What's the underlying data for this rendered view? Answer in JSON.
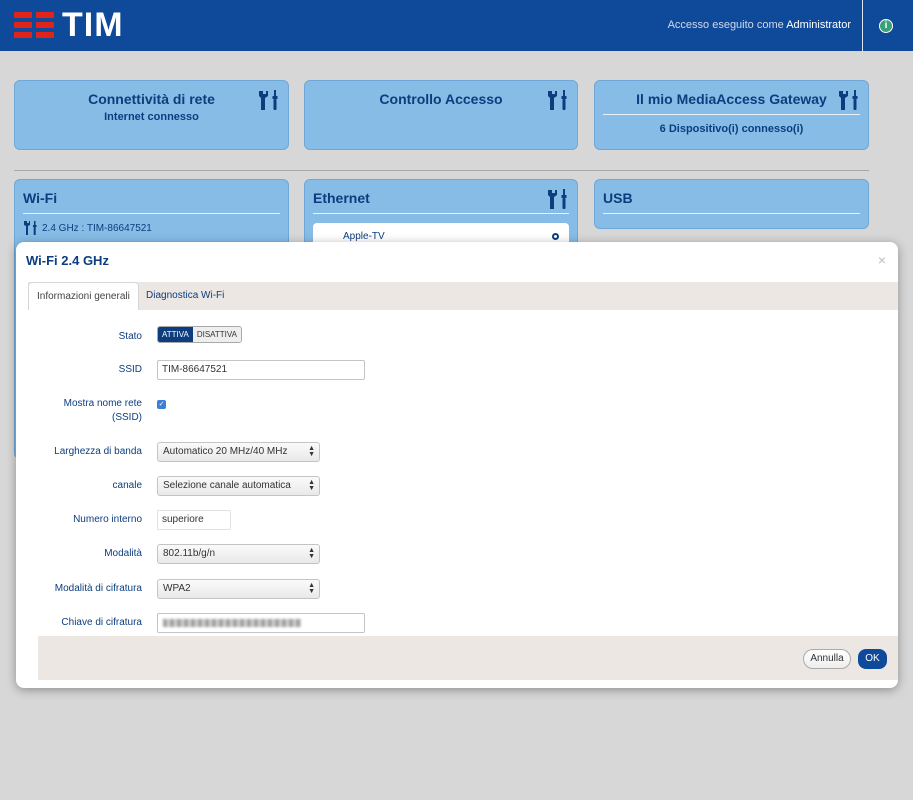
{
  "header": {
    "brand": "TIM",
    "login_prefix": "Accesso eseguito come",
    "login_user": "Administrator"
  },
  "cards": {
    "connectivity": {
      "title": "Connettività di rete",
      "subtitle": "Internet connesso"
    },
    "access_control": {
      "title": "Controllo Accesso"
    },
    "gateway": {
      "title": "Il mio MediaAccess Gateway",
      "subtitle": "6 Dispositivo(i) connesso(i)"
    },
    "wifi": {
      "title": "Wi-Fi",
      "band_label": "2.4 GHz : TIM-86647521"
    },
    "ethernet": {
      "title": "Ethernet",
      "device": "Apple-TV"
    },
    "usb": {
      "title": "USB"
    }
  },
  "modal": {
    "title": "Wi-Fi 2.4 GHz",
    "close": "×",
    "tabs": [
      "Informazioni generali",
      "Diagnostica Wi-Fi"
    ],
    "form": {
      "stato_label": "Stato",
      "stato_on": "ATTIVA",
      "stato_off": "DISATTIVA",
      "ssid_label": "SSID",
      "ssid_value": "TIM-86647521",
      "mostra_label_1": "Mostra nome rete",
      "mostra_label_2": "(SSID)",
      "banda_label": "Larghezza di banda",
      "banda_value": "Automatico 20 MHz/40 MHz",
      "canale_label": "canale",
      "canale_value": "Selezione canale automatica",
      "numero_label": "Numero interno",
      "numero_value": "superiore",
      "modalita_label": "Modalità",
      "modalita_value": "802.11b/g/n",
      "cifratura_label": "Modalità di cifratura",
      "cifratura_value": "WPA2",
      "chiave_label": "Chiave di cifratura"
    },
    "buttons": {
      "cancel": "Annulla",
      "ok": "OK"
    }
  }
}
